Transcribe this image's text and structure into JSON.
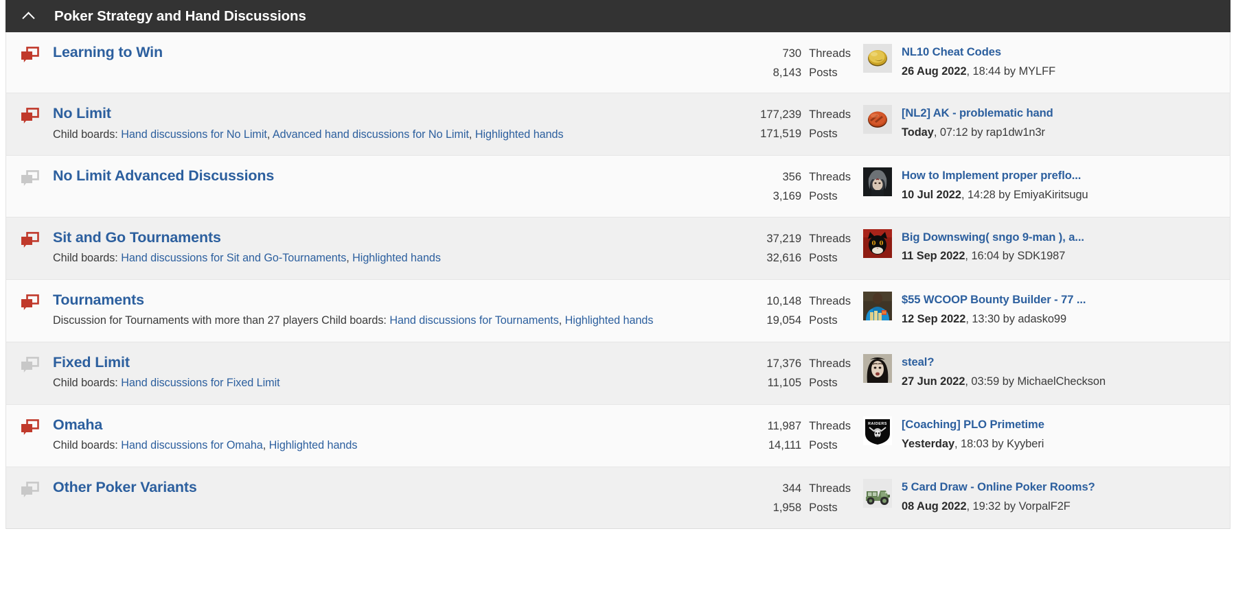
{
  "category": {
    "title": "Poker Strategy and Hand Discussions",
    "collapse_icon": "chevron-up-icon",
    "header_bg": "#333333",
    "link_color": "#2c5f9e",
    "icon_active_color": "#c0392b",
    "icon_inactive_color": "#c8c8c8"
  },
  "columns": {
    "threads_label": "Threads",
    "posts_label": "Posts"
  },
  "boards": [
    {
      "name": "Learning to Win",
      "icon": "board-icon-new-posts",
      "icon_state": "active",
      "description_prefix": "",
      "child_boards_label": "",
      "child_boards": [],
      "threads": "730",
      "posts": "8,143",
      "threads_label": "Threads",
      "posts_label": "Posts",
      "last_post": {
        "title": "NL10 Cheat Codes",
        "date": "26 Aug 2022",
        "time": "18:44",
        "by_prefix": "by",
        "author": "MYLFF",
        "avatar": "gold-coin-avatar"
      }
    },
    {
      "name": "No Limit",
      "icon": "board-icon-new-posts",
      "icon_state": "active",
      "description_prefix": "",
      "child_boards_label": "Child boards:",
      "child_boards": [
        "Hand discussions for No Limit",
        "Advanced hand discussions for No Limit",
        "Highlighted hands"
      ],
      "threads": "177,239",
      "posts": "171,519",
      "threads_label": "Threads",
      "posts_label": "Posts",
      "last_post": {
        "title": "[NL2] AK - problematic hand",
        "date": "Today",
        "time": "07:12",
        "by_prefix": "by",
        "author": "rap1dw1n3r",
        "avatar": "copper-coin-avatar"
      }
    },
    {
      "name": "No Limit Advanced Discussions",
      "icon": "board-icon-no-new-posts",
      "icon_state": "inactive",
      "description_prefix": "",
      "child_boards_label": "",
      "child_boards": [],
      "threads": "356",
      "posts": "3,169",
      "threads_label": "Threads",
      "posts_label": "Posts",
      "last_post": {
        "title": "How to Implement proper preflo...",
        "date": "10 Jul 2022",
        "time": "14:28",
        "by_prefix": "by",
        "author": "EmiyaKiritsugu",
        "avatar": "dark-portrait-avatar"
      }
    },
    {
      "name": "Sit and Go Tournaments",
      "icon": "board-icon-new-posts",
      "icon_state": "active",
      "description_prefix": "",
      "child_boards_label": "Child boards:",
      "child_boards": [
        "Hand discussions for Sit and Go-Tournaments",
        "Highlighted hands"
      ],
      "threads": "37,219",
      "posts": "32,616",
      "threads_label": "Threads",
      "posts_label": "Posts",
      "last_post": {
        "title": "Big Downswing( sngo 9-man ), a...",
        "date": "11 Sep 2022",
        "time": "16:04",
        "by_prefix": "by",
        "author": "SDK1987",
        "avatar": "black-cat-avatar"
      }
    },
    {
      "name": "Tournaments",
      "icon": "board-icon-new-posts",
      "icon_state": "active",
      "description_prefix": "Discussion for Tournaments with more than 27 players",
      "child_boards_label": "Child boards:",
      "child_boards": [
        "Hand discussions for Tournaments",
        "Highlighted hands"
      ],
      "threads": "10,148",
      "posts": "19,054",
      "threads_label": "Threads",
      "posts_label": "Posts",
      "last_post": {
        "title": "$55 WCOOP Bounty Builder - 77 ...",
        "date": "12 Sep 2022",
        "time": "13:30",
        "by_prefix": "by",
        "author": "adasko99",
        "avatar": "blue-hoodie-avatar"
      }
    },
    {
      "name": "Fixed Limit",
      "icon": "board-icon-no-new-posts",
      "icon_state": "inactive",
      "description_prefix": "",
      "child_boards_label": "Child boards:",
      "child_boards": [
        "Hand discussions for Fixed Limit"
      ],
      "threads": "17,376",
      "posts": "11,105",
      "threads_label": "Threads",
      "posts_label": "Posts",
      "last_post": {
        "title": "steal?",
        "date": "27 Jun 2022",
        "time": "03:59",
        "by_prefix": "by",
        "author": "MichaelCheckson",
        "avatar": "pale-face-avatar"
      }
    },
    {
      "name": "Omaha",
      "icon": "board-icon-new-posts",
      "icon_state": "active",
      "description_prefix": "",
      "child_boards_label": "Child boards:",
      "child_boards": [
        "Hand discussions for Omaha",
        "Highlighted hands"
      ],
      "threads": "11,987",
      "posts": "14,111",
      "threads_label": "Threads",
      "posts_label": "Posts",
      "last_post": {
        "title": "[Coaching] PLO Primetime",
        "date": "Yesterday",
        "time": "18:03",
        "by_prefix": "by",
        "author": "Kyyberi",
        "avatar": "raiders-logo-avatar"
      }
    },
    {
      "name": "Other Poker Variants",
      "icon": "board-icon-no-new-posts",
      "icon_state": "inactive",
      "description_prefix": "",
      "child_boards_label": "",
      "child_boards": [],
      "threads": "344",
      "posts": "1,958",
      "threads_label": "Threads",
      "posts_label": "Posts",
      "last_post": {
        "title": "5 Card Draw - Online Poker Rooms?",
        "date": "08 Aug 2022",
        "time": "19:32",
        "by_prefix": "by",
        "author": "VorpalF2F",
        "avatar": "green-truck-avatar"
      }
    }
  ]
}
